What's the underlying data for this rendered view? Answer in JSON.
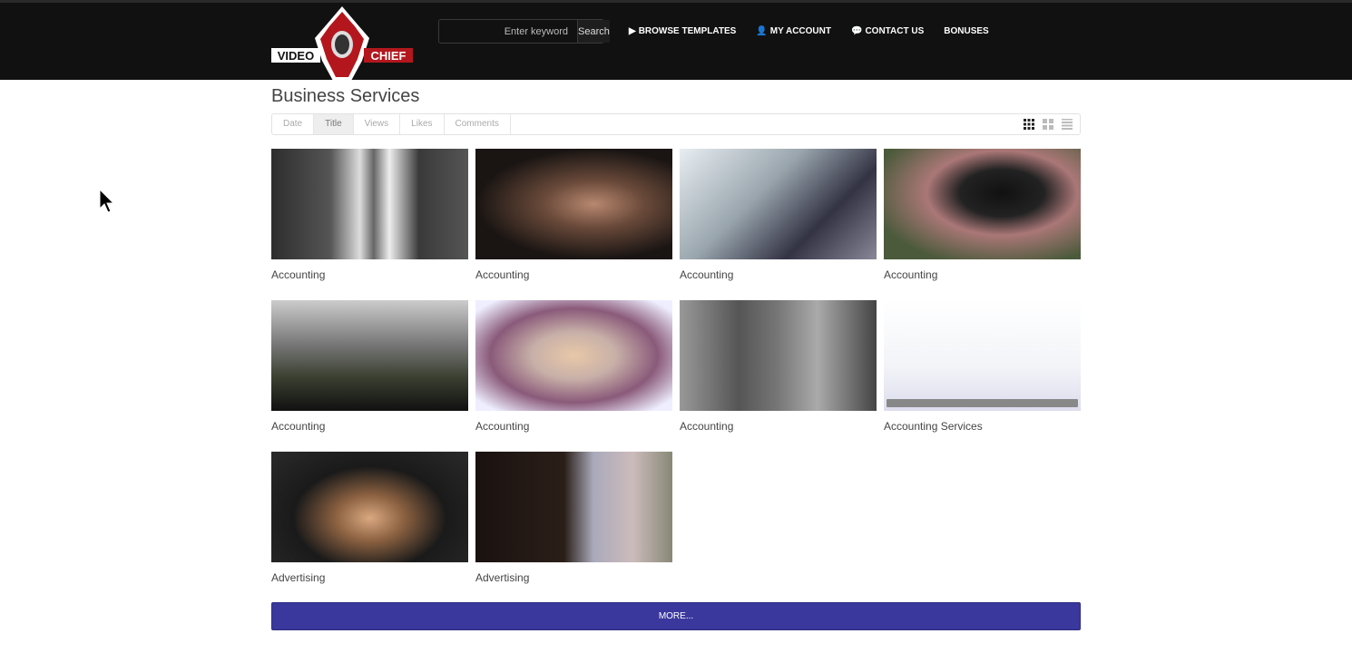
{
  "header": {
    "logo_text": [
      "VIDEO",
      "CHIEF"
    ],
    "search_placeholder": "Enter keyword",
    "search_button": "Search",
    "nav": [
      {
        "label": "BROWSE TEMPLATES",
        "icon": "play-circle-icon"
      },
      {
        "label": "MY ACCOUNT",
        "icon": "user-icon"
      },
      {
        "label": "CONTACT US",
        "icon": "comments-icon"
      },
      {
        "label": "BONUSES",
        "icon": ""
      }
    ]
  },
  "page_title": "Business Services",
  "sort_tabs": [
    {
      "label": "Date",
      "active": false
    },
    {
      "label": "Title",
      "active": true
    },
    {
      "label": "Views",
      "active": false
    },
    {
      "label": "Likes",
      "active": false
    },
    {
      "label": "Comments",
      "active": false
    }
  ],
  "view_modes": [
    "grid-small-icon",
    "grid-large-icon",
    "list-icon"
  ],
  "videos": [
    {
      "title": "Accounting"
    },
    {
      "title": "Accounting"
    },
    {
      "title": "Accounting"
    },
    {
      "title": "Accounting"
    },
    {
      "title": "Accounting"
    },
    {
      "title": "Accounting"
    },
    {
      "title": "Accounting"
    },
    {
      "title": "Accounting Services"
    },
    {
      "title": "Advertising"
    },
    {
      "title": "Advertising"
    }
  ],
  "more_button": "MORE..."
}
